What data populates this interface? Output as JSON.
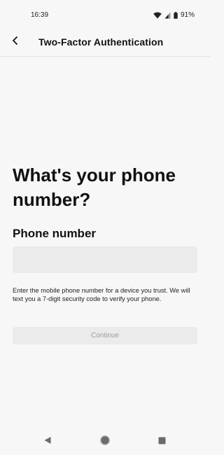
{
  "status_bar": {
    "time": "16:39",
    "battery": "91%",
    "icons": [
      "wifi-icon",
      "signal-icon",
      "battery-icon"
    ]
  },
  "app_bar": {
    "title": "Two-Factor Authentication",
    "back_icon": "chevron-left-icon"
  },
  "main": {
    "heading": "What's your phone number?",
    "field_label": "Phone number",
    "phone_value": "",
    "help_text": "Enter the mobile phone number for a device you trust. We will text you a 7-digit security code to verify your phone.",
    "continue_label": "Continue"
  },
  "nav_bar": {
    "icons": [
      "nav-back-icon",
      "nav-home-icon",
      "nav-recents-icon"
    ]
  },
  "colors": {
    "background": "#f7f7f7",
    "input_background": "#ebebeb",
    "text": "#111111",
    "disabled_text": "#9a9a9a"
  }
}
